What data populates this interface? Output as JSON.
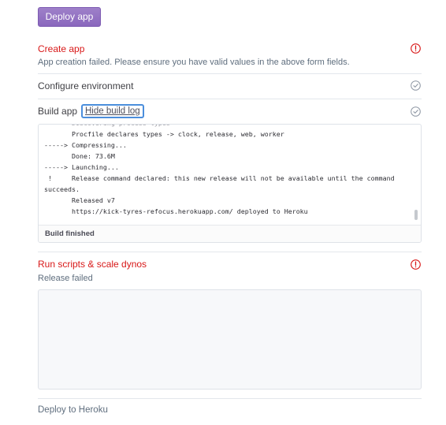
{
  "deploy_button": {
    "label": "Deploy app"
  },
  "steps": {
    "create_app": {
      "title": "Create app",
      "message": "App creation failed. Please ensure you have valid values in the above form fields."
    },
    "configure_env": {
      "title": "Configure environment"
    },
    "build_app": {
      "title": "Build app",
      "toggle_label": "Hide build log"
    },
    "run_scripts": {
      "title": "Run scripts & scale dynos",
      "message": "Release failed"
    }
  },
  "build_log": {
    "lines": [
      "       Procfile declares types -> clock, release, web, worker",
      "-----> Compressing...",
      "       Done: 73.6M",
      "-----> Launching...",
      " !     Release command declared: this new release will not be available until the command",
      "succeeds.",
      "       Released v7",
      "       https://kick-tyres-refocus.herokuapp.com/ deployed to Heroku"
    ],
    "status": "Build finished"
  },
  "footer": {
    "link": "Deploy to Heroku"
  },
  "colors": {
    "error": "#d81818",
    "success_icon": "#8d96a3",
    "button": "#8a67bd",
    "focus": "#4b8edc"
  },
  "icons": {
    "error": "exclamation-circle-icon",
    "success": "check-circle-icon"
  }
}
